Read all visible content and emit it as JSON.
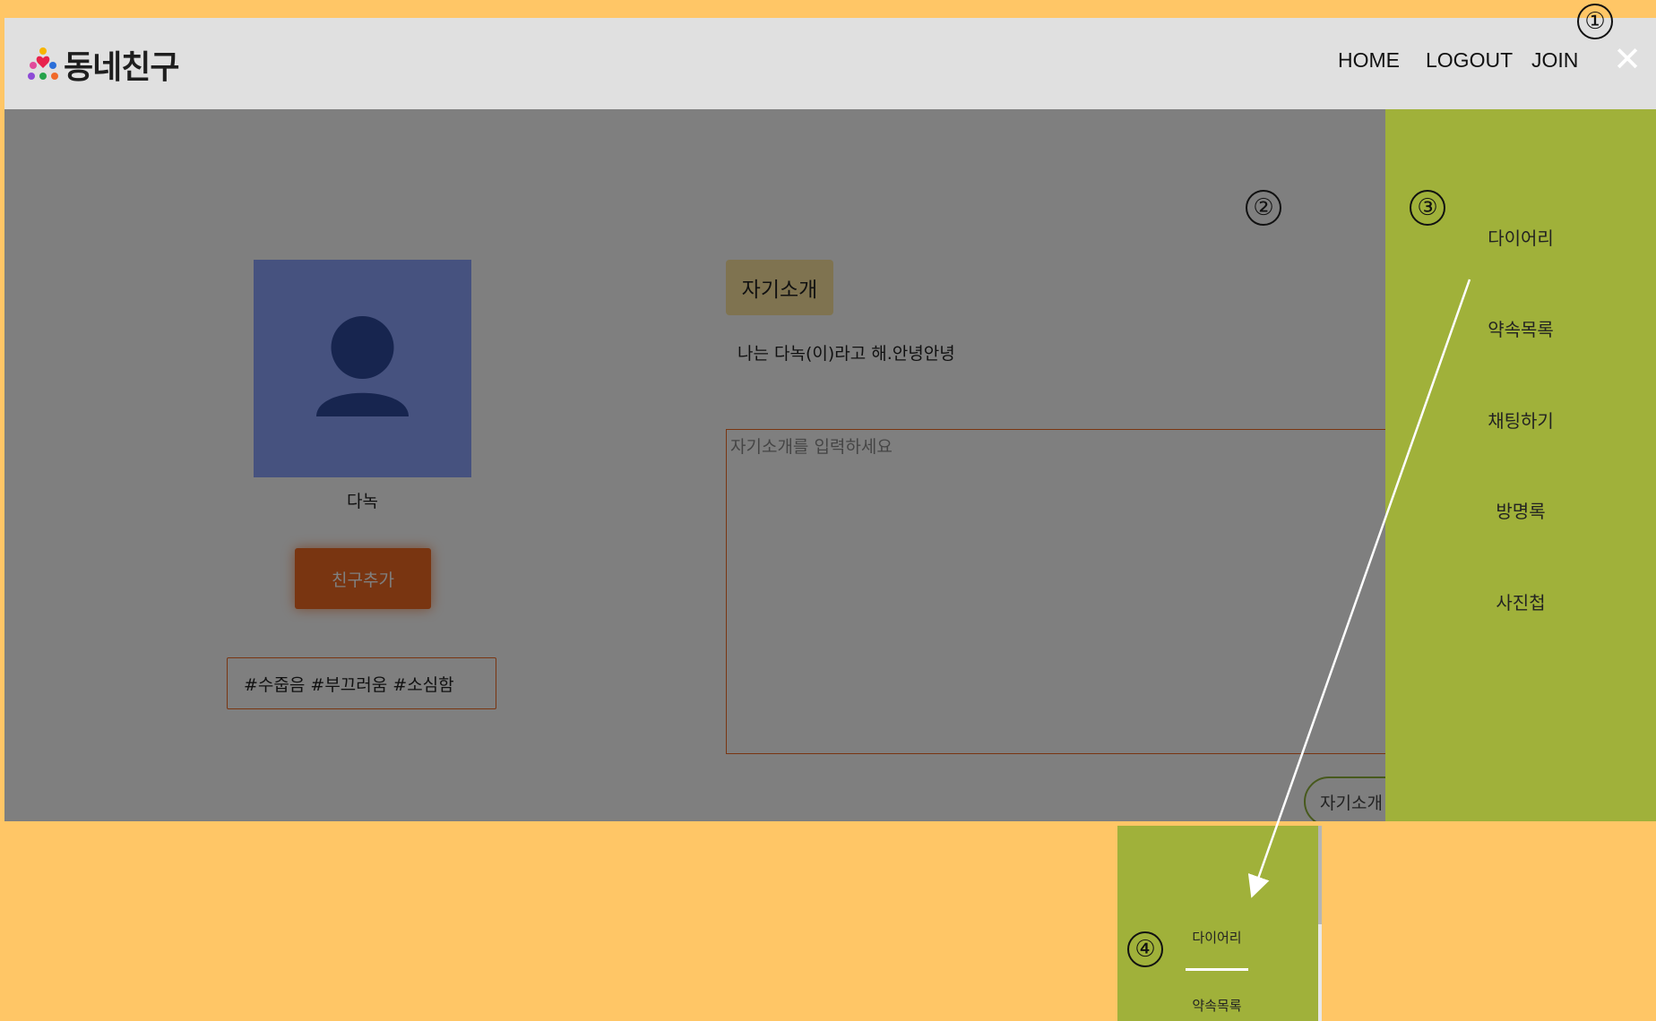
{
  "nav": {
    "logo_text": "동네친구",
    "links": [
      "HOME",
      "LOGOUT",
      "JOIN"
    ],
    "close_symbol": "✕"
  },
  "profile": {
    "username": "다녹",
    "add_friend_label": "친구추가",
    "tags": "#수줍음 #부끄러움 #소심함"
  },
  "intro": {
    "badge": "자기소개",
    "text": "나는 다녹(이)라고 해.안녕안녕",
    "placeholder": "자기소개를 입력하세요",
    "save_label": "자기소개"
  },
  "side_menu": {
    "items": [
      "다이어리",
      "약속목록",
      "채팅하기",
      "방명록",
      "사진첩"
    ]
  },
  "zoom_menu": {
    "items": [
      "다이어리",
      "약속목록"
    ]
  },
  "markers": [
    "①",
    "②",
    "③",
    "④"
  ],
  "colors": {
    "background": "#FFC666",
    "side_menu": "#A0B13A",
    "accent_orange": "#F36B22",
    "avatar": "#8da4ff",
    "badge": "#FFE7A1"
  },
  "icons": {
    "close": "close-icon",
    "avatar": "user-icon",
    "logo": "people-heart-icon"
  }
}
